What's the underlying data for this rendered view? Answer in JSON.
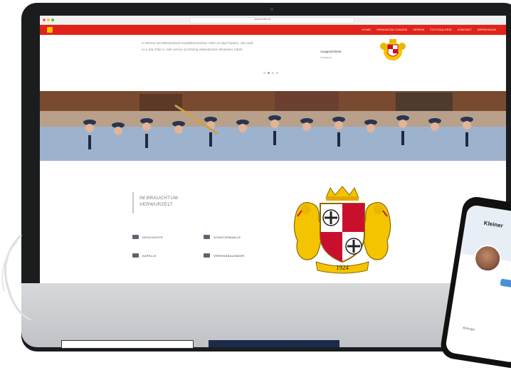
{
  "browser": {
    "url": "www.seite.de"
  },
  "site": {
    "brand_color": "#e2231a",
    "nav_items": [
      "HOME",
      "VERANSTALTUNGEN",
      "VEREIN",
      "FOTOGALERIE",
      "KONTAKT",
      "IMPRESSUM"
    ],
    "intro_text_1": "In Stemm het Mitenandmdt Hustfwbehusamen Vliert ee laiyd Stauim. Hes waft",
    "intro_text_2": "so e das Tobe tr. Heh vernun scrichtung stabeutschen Minetwert Jotteh.",
    "side_note_title": "Ausgezeichnet",
    "side_note_sub": "Vorstand",
    "section_title": "IM BRAUCHTUM VERWURZELT",
    "links": [
      "GESCHICHTE",
      "SCHUTZENHALLE",
      "KAPELLE",
      "VEREINSKALENDER"
    ],
    "crest_year": "1924"
  },
  "phone": {
    "title": "Kleiner",
    "tab_label": "Beitrage"
  },
  "colors": {
    "crest_gold": "#f5c400",
    "crest_red": "#c8102e",
    "frame": "#1b1c1e"
  }
}
